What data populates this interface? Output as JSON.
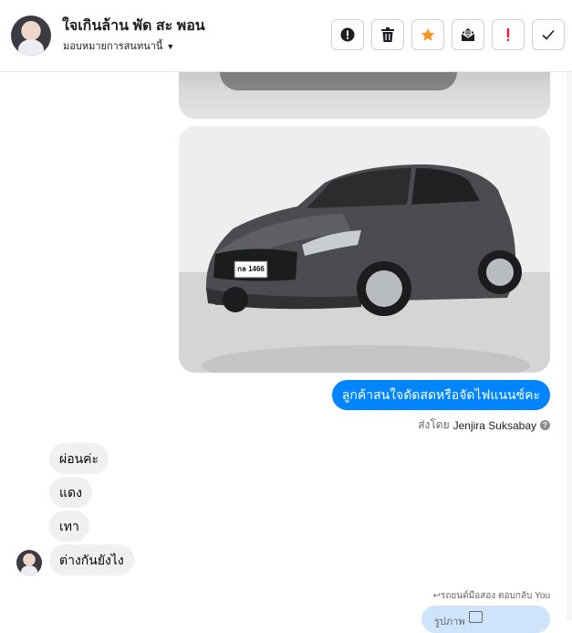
{
  "header": {
    "contact_name": "ใจเกินล้าน พัด สะ พอน",
    "assign_label": "มอบหมายการสนทนานี้",
    "actions": [
      {
        "name": "alert-button",
        "icon": "exclamation-circle-icon"
      },
      {
        "name": "delete-button",
        "icon": "trash-icon"
      },
      {
        "name": "star-button",
        "icon": "star-icon",
        "color": "#f7931e"
      },
      {
        "name": "mark-unread-button",
        "icon": "envelope-icon"
      },
      {
        "name": "spam-button",
        "icon": "exclamation-icon",
        "color": "#e41e3f"
      },
      {
        "name": "done-button",
        "icon": "check-icon"
      }
    ]
  },
  "messages": {
    "car_plate": "กล 1466",
    "outgoing_text": "ลูกค้าสนใจดัดสดหรือจัดไฟแนนซ์คะ",
    "sent_by_prefix": "ส่งโดย",
    "sent_by_name": "Jenjira Suksabay",
    "incoming": [
      "ผ่อนค่ะ",
      "แดง",
      "เทา",
      "ต่างกันยังไง"
    ],
    "reply_note": "รถยนต์มือสอง ตอบกลับ You",
    "reply_preview": "รูปภาพ"
  },
  "colors": {
    "accent_blue": "#0084ff",
    "incoming_bubble": "#f0f0f0",
    "reply_bubble": "#cde4fb"
  }
}
